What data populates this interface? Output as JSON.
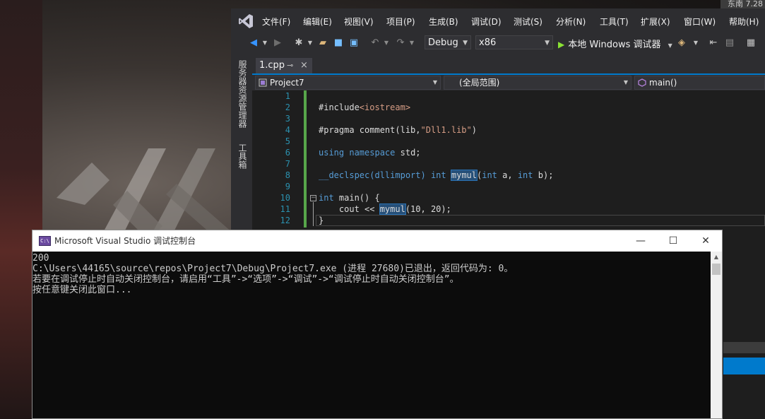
{
  "desktop": {
    "clock_partial": "东南 7.28"
  },
  "vs": {
    "menu": [
      "文件(F)",
      "编辑(E)",
      "视图(V)",
      "项目(P)",
      "生成(B)",
      "调试(D)",
      "测试(S)",
      "分析(N)",
      "工具(T)",
      "扩展(X)",
      "窗口(W)",
      "帮助(H)"
    ],
    "toolbar": {
      "config": "Debug",
      "platform": "x86",
      "run_label": "本地 Windows 调试器"
    },
    "side_tabs": [
      "服务器资源管理器",
      "工具箱"
    ],
    "tab": {
      "name": "1.cpp",
      "pin_glyph": "⊸",
      "close_glyph": "×"
    },
    "nav": {
      "project": "Project7",
      "scope": "(全局范围)",
      "member": "main()"
    },
    "code": {
      "line_numbers": [
        "1",
        "2",
        "3",
        "4",
        "5",
        "6",
        "7",
        "8",
        "9",
        "10",
        "11",
        "12"
      ],
      "l2_a": "#include",
      "l2_b": "<iostream>",
      "l4_a": "#pragma comment(lib,",
      "l4_b": "\"Dll1.lib\"",
      "l4_c": ")",
      "l6_a": "using",
      "l6_b": " ",
      "l6_c": "namespace",
      "l6_d": " std;",
      "l8_a": "__declspec(dllimport) ",
      "l8_b": "int",
      "l8_c": " ",
      "l8_d": "mymul",
      "l8_e": "(",
      "l8_f": "int",
      "l8_g": " a, ",
      "l8_h": "int",
      "l8_i": " b);",
      "l10_a": "int",
      "l10_b": " main() {",
      "l11_a": "    cout << ",
      "l11_b": "mymul",
      "l11_c": "(10, 20);",
      "l12_a": "}"
    }
  },
  "console": {
    "title": "Microsoft Visual Studio 调试控制台",
    "icon_text": "C:\\",
    "buttons": {
      "minimize": "—",
      "maximize": "☐",
      "close": "✕"
    },
    "lines": [
      "200",
      "C:\\Users\\44165\\source\\repos\\Project7\\Debug\\Project7.exe (进程 27680)已退出，返回代码为: 0。",
      "若要在调试停止时自动关闭控制台，请启用“工具”->“选项”->“调试”->“调试停止时自动关闭控制台”。",
      "按任意键关闭此窗口..."
    ]
  }
}
